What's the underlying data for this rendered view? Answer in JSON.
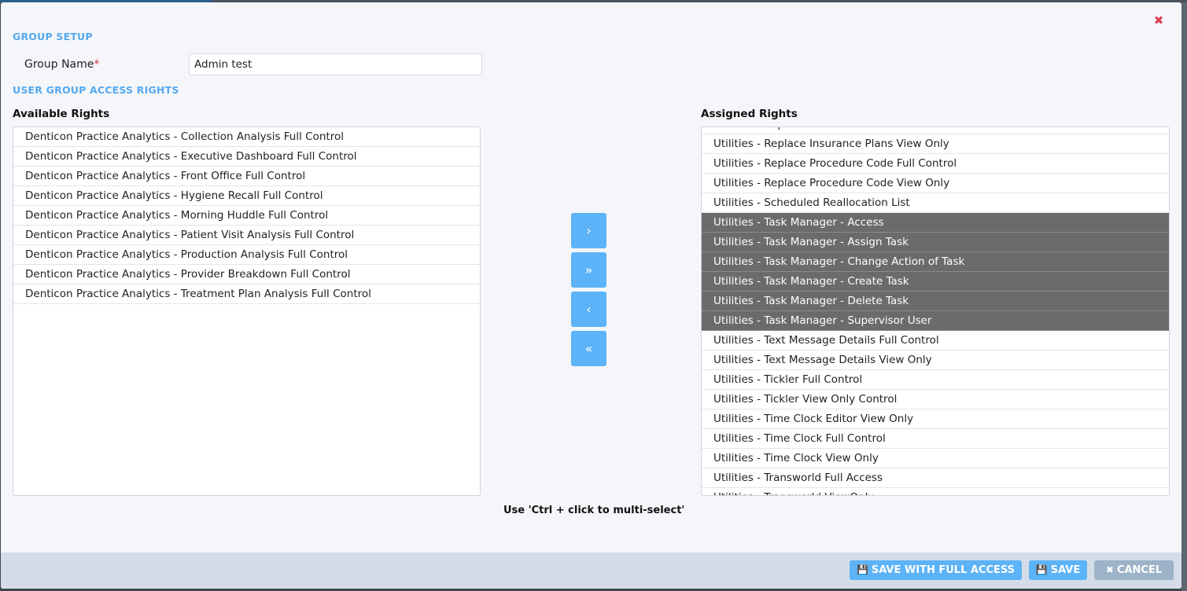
{
  "group_setup": {
    "title": "GROUP SETUP",
    "name_label": "Group Name",
    "required_mark": "*",
    "name_value": "Admin test"
  },
  "access_rights": {
    "title": "USER GROUP ACCESS RIGHTS",
    "available_label": "Available Rights",
    "assigned_label": "Assigned Rights",
    "available": [
      "Denticon Practice Analytics - Collection Analysis Full Control",
      "Denticon Practice Analytics - Executive Dashboard Full Control",
      "Denticon Practice Analytics - Front Office Full Control",
      "Denticon Practice Analytics - Hygiene Recall Full Control",
      "Denticon Practice Analytics - Morning Huddle Full Control",
      "Denticon Practice Analytics - Patient Visit Analysis Full Control",
      "Denticon Practice Analytics - Production Analysis Full Control",
      "Denticon Practice Analytics - Provider Breakdown Full Control",
      "Denticon Practice Analytics - Treatment Plan Analysis Full Control"
    ],
    "assigned": [
      {
        "label": "Utilities - Replace Insurance Plans Full Control",
        "selected": false
      },
      {
        "label": "Utilities - Replace Insurance Plans View Only",
        "selected": false
      },
      {
        "label": "Utilities - Replace Procedure Code Full Control",
        "selected": false
      },
      {
        "label": "Utilities - Replace Procedure Code View Only",
        "selected": false
      },
      {
        "label": "Utilities - Scheduled Reallocation List",
        "selected": false
      },
      {
        "label": "Utilities - Task Manager - Access",
        "selected": true
      },
      {
        "label": "Utilities - Task Manager - Assign Task",
        "selected": true
      },
      {
        "label": "Utilities - Task Manager - Change Action of Task",
        "selected": true
      },
      {
        "label": "Utilities - Task Manager - Create Task",
        "selected": true
      },
      {
        "label": "Utilities - Task Manager - Delete Task",
        "selected": true
      },
      {
        "label": "Utilities - Task Manager - Supervisor User",
        "selected": true
      },
      {
        "label": "Utilities - Text Message Details Full Control",
        "selected": false
      },
      {
        "label": "Utilities - Text Message Details View Only",
        "selected": false
      },
      {
        "label": "Utilities - Tickler Full Control",
        "selected": false
      },
      {
        "label": "Utilities - Tickler View Only Control",
        "selected": false
      },
      {
        "label": "Utilities - Time Clock Editor View Only",
        "selected": false
      },
      {
        "label": "Utilities - Time Clock Full Control",
        "selected": false
      },
      {
        "label": "Utilities - Time Clock View Only",
        "selected": false
      },
      {
        "label": "Utilities - Transworld Full Access",
        "selected": false
      },
      {
        "label": "Utilities - Transworld ViewOnly",
        "selected": false
      }
    ],
    "move_buttons": {
      "add_one": "›",
      "add_all": "»",
      "remove_one": "‹",
      "remove_all": "«"
    },
    "hint": "Use 'Ctrl + click to multi-select'"
  },
  "footer": {
    "save_full_access_label": "SAVE WITH FULL ACCESS",
    "save_label": "SAVE",
    "cancel_label": "CANCEL",
    "save_icon": "floppy-disk-icon",
    "cancel_icon": "x-icon"
  },
  "colors": {
    "section_title": "#56a9ef",
    "button": "#5cb3f7",
    "cancel_button": "#9cb3c8",
    "selected_row": "#6b6b6b",
    "close_icon": "#e0405a"
  }
}
